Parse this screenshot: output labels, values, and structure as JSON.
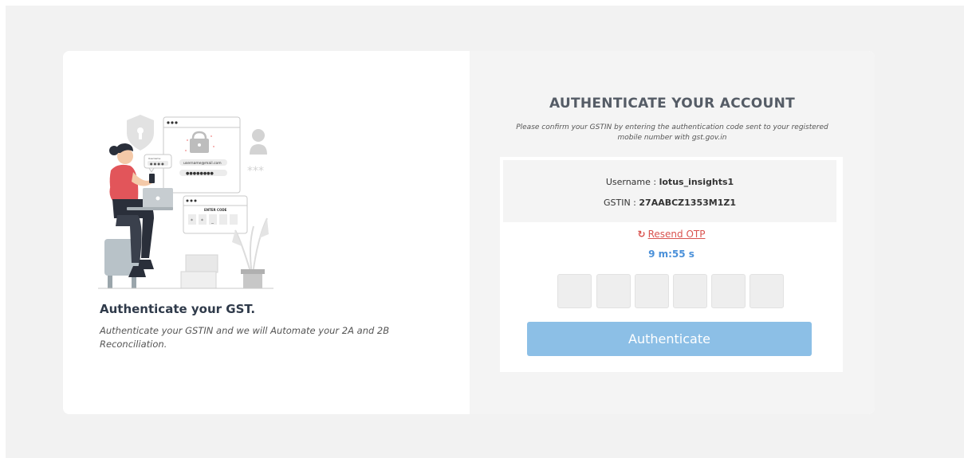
{
  "left": {
    "title": "Authenticate your GST.",
    "description": "Authenticate your GSTIN and we will Automate your 2A and 2B Reconciliation.",
    "illustration": {
      "chat_label": "Username",
      "chat_dots": "● ● ● ●",
      "email_field": "username@mail.com",
      "password_field": "●●●●●●●●",
      "stars": "***",
      "enter_code_label": "ENTER CODE",
      "code_boxes": [
        "*",
        "*",
        "_"
      ]
    }
  },
  "right": {
    "title": "AUTHENTICATE YOUR ACCOUNT",
    "subtitle": "Please confirm your GSTIN by entering the authentication code sent to your registered mobile number with gst.gov.in",
    "username_label": "Username : ",
    "username_value": "lotus_insights1",
    "gstin_label": "GSTIN : ",
    "gstin_value": "27AABCZ1353M1Z1",
    "resend_label": "Resend OTP",
    "resend_icon": "refresh-icon",
    "timer": "9 m:55 s",
    "otp_count": 6,
    "authenticate_label": "Authenticate"
  },
  "colors": {
    "page_bg": "#f2f2f2",
    "panel_bg": "#f4f4f4",
    "resend": "#d9534f",
    "timer": "#4a90d9",
    "button": "#8cbfe6"
  }
}
